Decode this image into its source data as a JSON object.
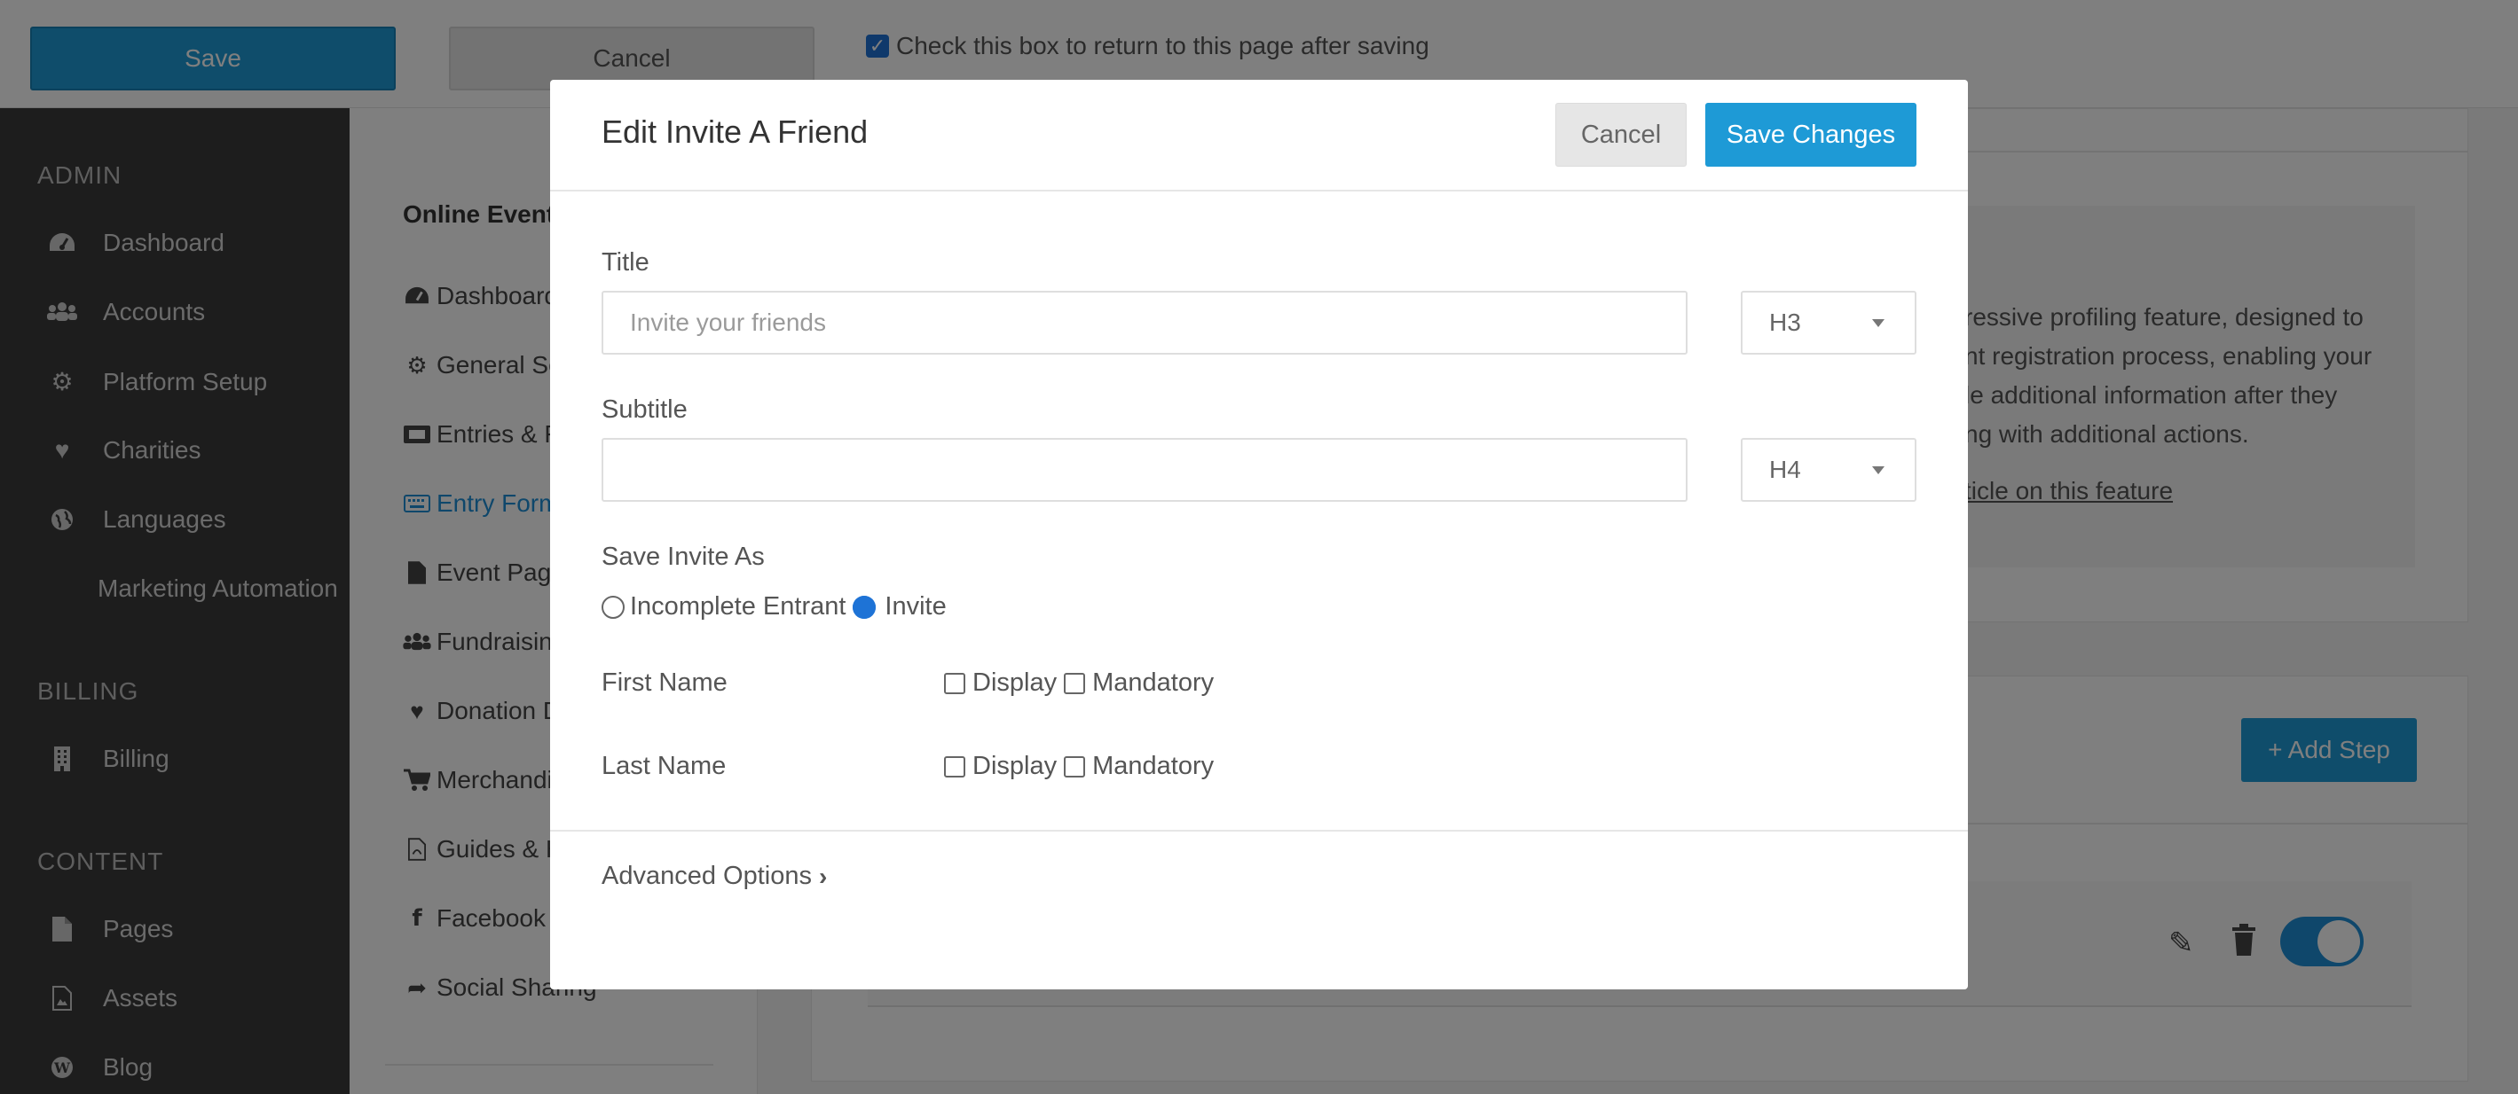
{
  "topbar": {
    "save_label": "Save",
    "cancel_label": "Cancel",
    "return_checkbox_label": "Check this box to return to this page after saving",
    "return_checked": true
  },
  "sidebar": {
    "admin_heading": "ADMIN",
    "admin_items": [
      {
        "label": "Dashboard",
        "icon": "dashboard-icon"
      },
      {
        "label": "Accounts",
        "icon": "users-icon"
      },
      {
        "label": "Platform Setup",
        "icon": "cogs-icon"
      },
      {
        "label": "Charities",
        "icon": "heart-icon"
      },
      {
        "label": "Languages",
        "icon": "globe-icon"
      }
    ],
    "marketing_label": "Marketing Automation",
    "billing_heading": "BILLING",
    "billing_item": {
      "label": "Billing",
      "icon": "building-icon"
    },
    "content_heading": "CONTENT",
    "content_items": [
      {
        "label": "Pages",
        "icon": "file-icon"
      },
      {
        "label": "Assets",
        "icon": "file-image-icon"
      },
      {
        "label": "Blog",
        "icon": "wordpress-icon"
      }
    ]
  },
  "subnav": {
    "title": "Online Event (",
    "items": [
      {
        "label": "Dashboard",
        "icon": "dashboard-icon"
      },
      {
        "label": "General Se",
        "icon": "gear-icon"
      },
      {
        "label": "Entries & F",
        "icon": "ticket-icon"
      },
      {
        "label": "Entry Form",
        "icon": "keyboard-icon",
        "active": true
      },
      {
        "label": "Event Page",
        "icon": "file-icon"
      },
      {
        "label": "Fundraisin",
        "icon": "users-icon"
      },
      {
        "label": "Donation D",
        "icon": "heart-icon"
      },
      {
        "label": "Merchandi",
        "icon": "cart-icon"
      },
      {
        "label": "Guides & H",
        "icon": "file-pdf-icon"
      },
      {
        "label": "Facebook F",
        "icon": "facebook-icon"
      },
      {
        "label": "Social Sharing",
        "icon": "share-icon"
      }
    ]
  },
  "content": {
    "info_lines": [
      "ressive profiling feature, designed to",
      "nt registration process, enabling your",
      "le additional information after they",
      "ng with additional actions."
    ],
    "info_link": "ticle on this feature",
    "add_step_label": "+ Add Step",
    "toggle_on": true
  },
  "modal": {
    "title": "Edit Invite A Friend",
    "cancel_label": "Cancel",
    "save_label": "Save Changes",
    "title_label": "Title",
    "title_placeholder": "Invite your friends",
    "title_value": "",
    "title_heading": "H3",
    "subtitle_label": "Subtitle",
    "subtitle_value": "",
    "subtitle_heading": "H4",
    "save_as_label": "Save Invite As",
    "save_as_options": [
      {
        "label": "Incomplete Entrant",
        "checked": false
      },
      {
        "label": "Invite",
        "checked": true
      }
    ],
    "fields": [
      {
        "label": "First Name",
        "display_label": "Display",
        "mandatory_label": "Mandatory",
        "display": false,
        "mandatory": false
      },
      {
        "label": "Last Name",
        "display_label": "Display",
        "mandatory_label": "Mandatory",
        "display": false,
        "mandatory": false
      }
    ],
    "advanced_label": "Advanced Options"
  },
  "colors": {
    "accent": "#1e9ad6",
    "sidebar_bg": "#3a3a3a",
    "active_link": "#1e8fd6"
  }
}
